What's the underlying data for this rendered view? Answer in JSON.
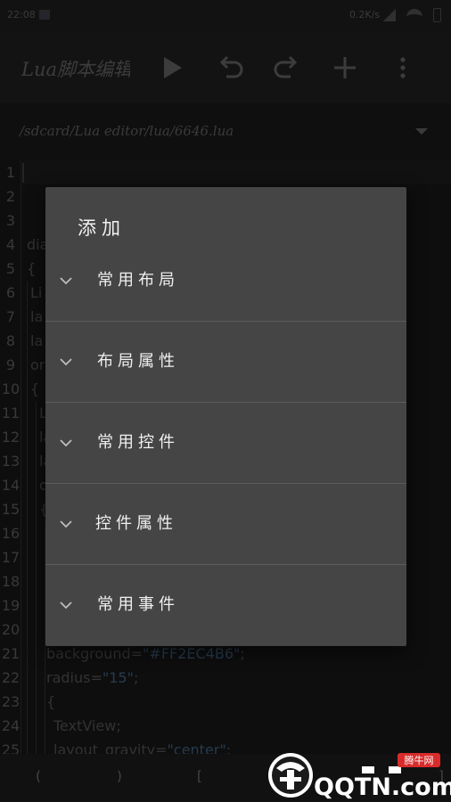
{
  "status_bar": {
    "time": "22:08",
    "net_speed": "0.2K/s"
  },
  "toolbar": {
    "app_title": "Lua脚本编辑器",
    "icons": [
      "play-icon",
      "undo-icon",
      "redo-icon",
      "add-icon",
      "more-vert-icon"
    ]
  },
  "path_bar": {
    "path": "/sdcard/Lua editor/lua/6646.lua"
  },
  "editor": {
    "line_numbers": [
      "1",
      "2",
      "3",
      "4",
      "5",
      "6",
      "7",
      "8",
      "9",
      "10",
      "11",
      "12",
      "13",
      "14",
      "15",
      "16",
      "17",
      "18",
      "19",
      "20",
      "21",
      "22",
      "23",
      "24",
      "25"
    ],
    "code": {
      "l4": "dia",
      "l5": "{",
      "l6": "Li",
      "l7": "la",
      "l8": "la",
      "l9": "or",
      "l10": "{",
      "l11": "L",
      "l12": "la",
      "l13": "la",
      "l14": "or",
      "l15": "{",
      "l21_key": "background=",
      "l21_val": "\"#FF2EC4B6\"",
      "l21_end": ";",
      "l22_key": "radius=",
      "l22_val": "\"15\"",
      "l22_end": ";",
      "l23": "{",
      "l24": "TextView;",
      "l25_key": "layout_gravity=",
      "l25_val": "\"center\"",
      "l25_end": ";"
    }
  },
  "symbols": [
    "(",
    ")",
    "[",
    "]"
  ],
  "watermark": {
    "text": "QQTN.com",
    "badge": "腾牛网"
  },
  "dialog": {
    "title": "添加",
    "groups": [
      {
        "label": "常用布局"
      },
      {
        "label": "布局属性"
      },
      {
        "label": "常用控件"
      },
      {
        "label": "控件属性"
      },
      {
        "label": "常用事件"
      }
    ]
  }
}
